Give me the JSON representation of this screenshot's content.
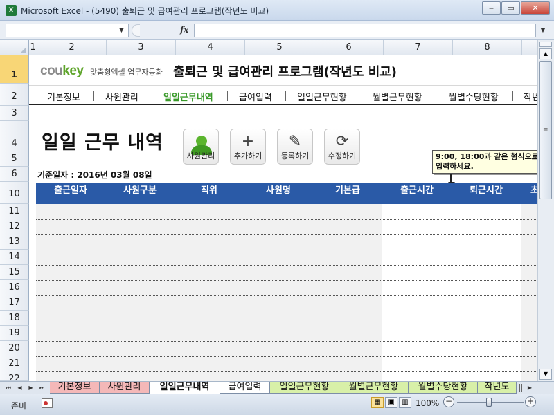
{
  "window": {
    "title": "Microsoft Excel - (5490) 출퇴근 및 급여관리 프로그램(작년도 비교)",
    "app_icon": "X",
    "minimize_symbol": "‒",
    "maximize_symbol": "▭",
    "close_symbol": "✕"
  },
  "formula_bar": {
    "name_box": "",
    "fx_label": "fx",
    "formula": ""
  },
  "columns": [
    "1",
    "2",
    "3",
    "4",
    "5",
    "6",
    "7",
    "8"
  ],
  "rows": [
    "1",
    "2",
    "3",
    "4",
    "5",
    "6",
    "10",
    "11",
    "12",
    "13",
    "14",
    "15",
    "16",
    "17",
    "18",
    "19",
    "20",
    "21",
    "22"
  ],
  "sheet": {
    "brand_cou": "cou",
    "brand_key": "key",
    "brand_sub": "맞춤형엑셀 업무자동화",
    "app_title": "출퇴근 및 급여관리 프로그램(작년도 비교)",
    "nav": [
      "기본정보",
      "사원관리",
      "일일근무내역",
      "급여입력",
      "일일근무현황",
      "월별근무현황",
      "월별수당현황",
      "작년"
    ],
    "page_title": "일일 근무 내역",
    "buttons": {
      "employee": "사원관리",
      "add": "추가하기",
      "register": "등록하기",
      "edit": "수정하기"
    },
    "std_date": "기준일자 : 2016년 03월 08일",
    "comment": "9:00, 18:00과 같은 형식으로 입력하세요.",
    "table_headers": [
      "출근일자",
      "사원구분",
      "직위",
      "사원명",
      "기본급",
      "출근시간",
      "퇴근시간",
      "초"
    ]
  },
  "tabs": [
    "기본정보",
    "사원관리",
    "일일근무내역",
    "급여입력",
    "일일근무현황",
    "월별근무현황",
    "월별수당현황",
    "작년도"
  ],
  "active_tab": "일일근무내역",
  "status": {
    "ready": "준비",
    "zoom": "100%"
  },
  "colors": {
    "table_header": "#2a5aa7",
    "nav_active": "#3a9a2a",
    "brand_green": "#5fa52c",
    "selected_row_header": "#f8d676",
    "red_tab": "#f4b8b8",
    "green_tab": "#d8f0a8"
  }
}
